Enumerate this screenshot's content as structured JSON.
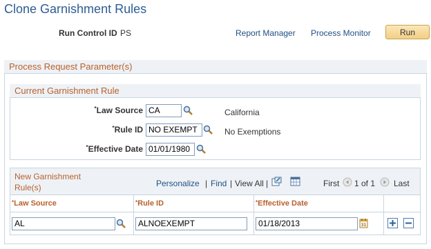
{
  "page": {
    "title": "Clone Garnishment Rules"
  },
  "run_control": {
    "label": "Run Control ID",
    "value": "PS"
  },
  "links": {
    "report_manager": "Report Manager",
    "process_monitor": "Process Monitor"
  },
  "run_button": "Run",
  "params_section": {
    "title": "Process Request Parameter(s)"
  },
  "current_rule": {
    "title": "Current Garnishment Rule",
    "law_source": {
      "label": "Law Source",
      "value": "CA",
      "description": "California"
    },
    "rule_id": {
      "label": "Rule ID",
      "value": "NO EXEMPT",
      "description": "No Exemptions"
    },
    "effective_date": {
      "label": "Effective Date",
      "value": "01/01/1980"
    }
  },
  "new_rules": {
    "title_line1": "New Garnishment",
    "title_line2": "Rule(s)",
    "personalize": "Personalize",
    "find": "Find",
    "view_all": "View All",
    "first": "First",
    "count": "1 of 1",
    "last": "Last",
    "columns": {
      "law_source": "Law Source",
      "rule_id": "Rule ID",
      "effective_date": "Effective Date"
    },
    "rows": [
      {
        "law_source": "AL",
        "rule_id": "ALNOEXEMPT",
        "effective_date": "01/18/2013"
      }
    ]
  },
  "colors": {
    "title": "#2d5d93",
    "section_header": "#b8602c",
    "link": "#1f4f82"
  }
}
